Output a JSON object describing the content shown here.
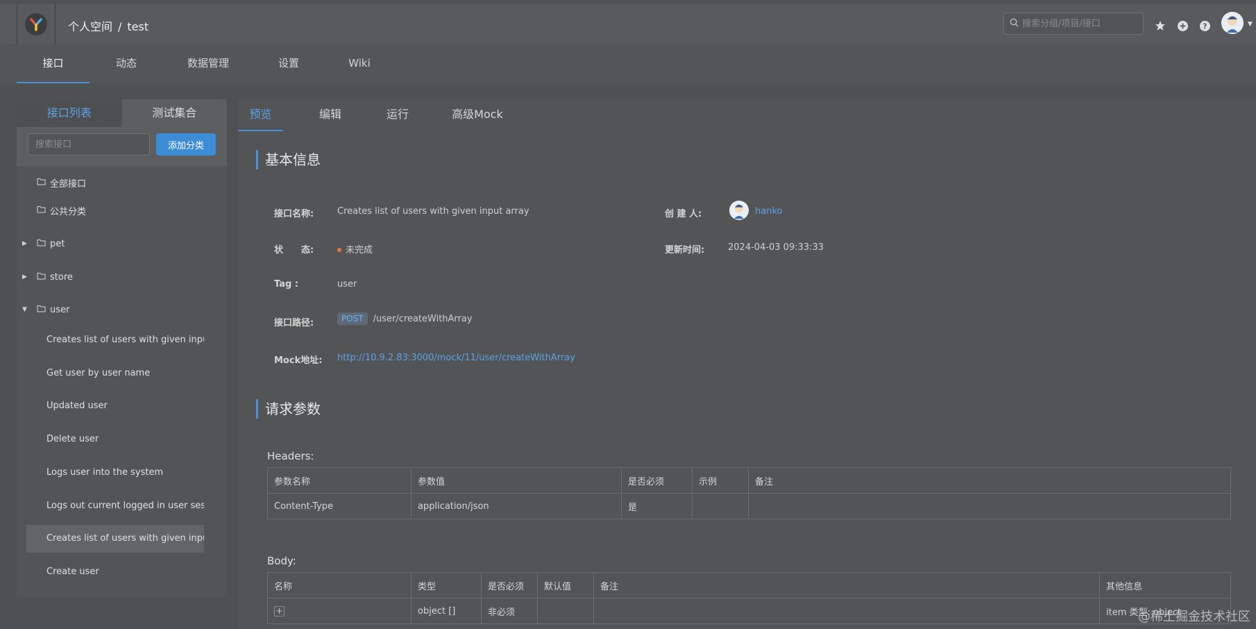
{
  "header": {
    "breadcrumb_space": "个人空间",
    "breadcrumb_sep": "/",
    "breadcrumb_project": "test",
    "search_placeholder": "搜索分组/项目/接口",
    "icons": [
      "star-icon",
      "plus-circle-icon",
      "help-icon"
    ]
  },
  "subnav": {
    "tabs": [
      {
        "label": "接口"
      },
      {
        "label": "动态"
      },
      {
        "label": "数据管理"
      },
      {
        "label": "设置"
      },
      {
        "label": "Wiki"
      }
    ],
    "active_index": 0
  },
  "sidebar": {
    "tabs": [
      {
        "label": "接口列表"
      },
      {
        "label": "测试集合"
      }
    ],
    "search_placeholder": "搜索接口",
    "add_button": "添加分类",
    "tree": [
      {
        "label": "全部接口"
      },
      {
        "label": "公共分类"
      },
      {
        "label": "pet"
      },
      {
        "label": "store"
      },
      {
        "label": "user"
      }
    ],
    "user_items": [
      {
        "label": "Creates list of users with given input array"
      },
      {
        "label": "Get user by user name"
      },
      {
        "label": "Updated user"
      },
      {
        "label": "Delete user"
      },
      {
        "label": "Logs user into the system"
      },
      {
        "label": "Logs out current logged in user session"
      },
      {
        "label": "Creates list of users with given input array"
      },
      {
        "label": "Create user"
      }
    ]
  },
  "main": {
    "tabs": [
      {
        "label": "预览"
      },
      {
        "label": "编辑"
      },
      {
        "label": "运行"
      },
      {
        "label": "高级Mock"
      }
    ],
    "basic_info": {
      "title": "基本信息",
      "name_label": "接口名称:",
      "name_value": "Creates list of users with given input array",
      "creator_label": "创 建 人:",
      "creator_value": "hanko",
      "status_label": "状　　态:",
      "status_value": "未完成",
      "updated_label": "更新时间:",
      "updated_value": "2024-04-03 09:33:33",
      "tag_label": "Tag :",
      "tag_value": "user",
      "path_label": "接口路径:",
      "method": "POST",
      "path_value": "/user/createWithArray",
      "mock_label": "Mock地址:",
      "mock_value": "http://10.9.2.83:3000/mock/11/user/createWithArray"
    },
    "request_params": {
      "title": "请求参数",
      "headers_label": "Headers:",
      "headers_columns": [
        "参数名称",
        "参数值",
        "是否必须",
        "示例",
        "备注"
      ],
      "headers_rows": [
        [
          "Content-Type",
          "application/json",
          "是",
          "",
          ""
        ]
      ],
      "body_label": "Body:",
      "body_columns": [
        "名称",
        "类型",
        "是否必须",
        "默认值",
        "备注",
        "其他信息"
      ],
      "body_rows": [
        [
          "+",
          "object []",
          "非必须",
          "",
          "",
          "item 类型: object"
        ]
      ]
    }
  },
  "watermark": "@稀土掘金技术社区",
  "colors": {
    "accent": "#4a90d9",
    "link": "#5aa2e8",
    "status_dot": "#e8733c",
    "background": "#4f5052"
  }
}
